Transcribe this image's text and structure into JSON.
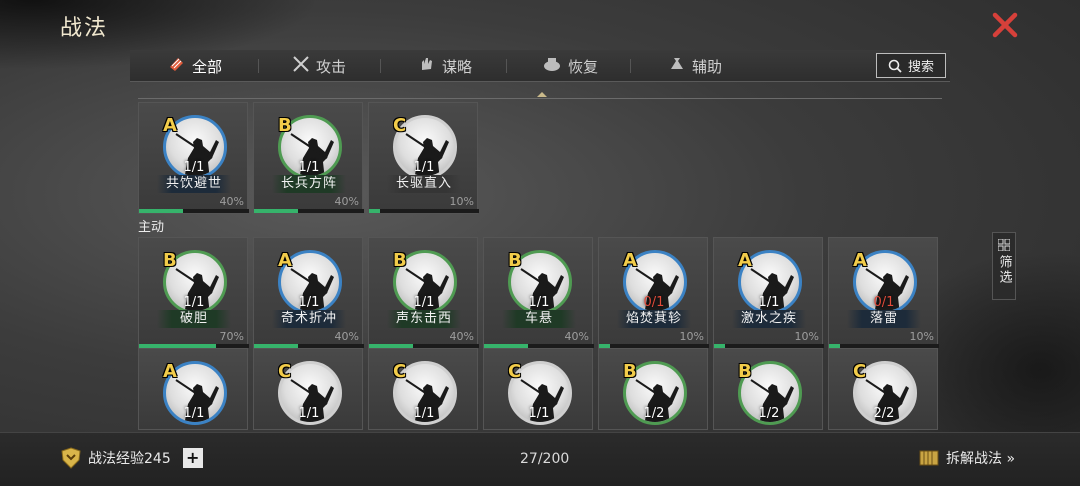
{
  "title": "战法",
  "tabs": [
    {
      "label": "全部",
      "icon": "scroll-icon",
      "active": true
    },
    {
      "label": "攻击",
      "icon": "crossed-swords-icon",
      "active": false
    },
    {
      "label": "谋略",
      "icon": "hand-icon",
      "active": false
    },
    {
      "label": "恢复",
      "icon": "pot-icon",
      "active": false
    },
    {
      "label": "辅助",
      "icon": "bag-icon",
      "active": false
    }
  ],
  "search_label": "搜索",
  "passive_cards": [
    {
      "grade": "A",
      "level": "1/1",
      "name": "共饮避世",
      "pct": "40%",
      "progress": 0.4,
      "ring": "A",
      "plate": "blue"
    },
    {
      "grade": "B",
      "level": "1/1",
      "name": "长兵方阵",
      "pct": "40%",
      "progress": 0.4,
      "ring": "B",
      "plate": "green"
    },
    {
      "grade": "C",
      "level": "1/1",
      "name": "长驱直入",
      "pct": "10%",
      "progress": 0.1,
      "ring": "C",
      "plate": "gray"
    }
  ],
  "section_active_label": "主动",
  "active_cards": [
    {
      "grade": "B",
      "level": "1/1",
      "name": "破胆",
      "pct": "70%",
      "progress": 0.7,
      "ring": "B",
      "plate": "green"
    },
    {
      "grade": "A",
      "level": "1/1",
      "name": "奇术折冲",
      "pct": "40%",
      "progress": 0.4,
      "ring": "A",
      "plate": "blue"
    },
    {
      "grade": "B",
      "level": "1/1",
      "name": "声东击西",
      "pct": "40%",
      "progress": 0.4,
      "ring": "B",
      "plate": "green"
    },
    {
      "grade": "B",
      "level": "1/1",
      "name": "车悬",
      "pct": "40%",
      "progress": 0.4,
      "ring": "B",
      "plate": "green"
    },
    {
      "grade": "A",
      "level": "0/1",
      "name": "焰焚萁轸",
      "pct": "10%",
      "progress": 0.1,
      "ring": "A",
      "plate": "blue",
      "red": true
    },
    {
      "grade": "A",
      "level": "1/1",
      "name": "激水之疾",
      "pct": "10%",
      "progress": 0.1,
      "ring": "A",
      "plate": "blue"
    },
    {
      "grade": "A",
      "level": "0/1",
      "name": "落雷",
      "pct": "10%",
      "progress": 0.1,
      "ring": "A",
      "plate": "blue",
      "red": true
    }
  ],
  "third_row_cards": [
    {
      "grade": "A",
      "level": "1/1",
      "ring": "A"
    },
    {
      "grade": "C",
      "level": "1/1",
      "ring": "C"
    },
    {
      "grade": "C",
      "level": "1/1",
      "ring": "C"
    },
    {
      "grade": "C",
      "level": "1/1",
      "ring": "C"
    },
    {
      "grade": "B",
      "level": "1/2",
      "ring": "B"
    },
    {
      "grade": "B",
      "level": "1/2",
      "ring": "B"
    },
    {
      "grade": "C",
      "level": "2/2",
      "ring": "C"
    }
  ],
  "filter_label": "筛选",
  "footer": {
    "exp_label": "战法经验245",
    "plus": "+",
    "count": "27/200",
    "dismantle_label": "拆解战法 »"
  },
  "colors": {
    "accent": "#e05a3a",
    "grade_gold": "#f2cc4a",
    "progress_green": "#36b36b",
    "ring_A": "#3b82c4",
    "ring_B": "#4f9b52",
    "ring_C": "#cfcfcf"
  }
}
